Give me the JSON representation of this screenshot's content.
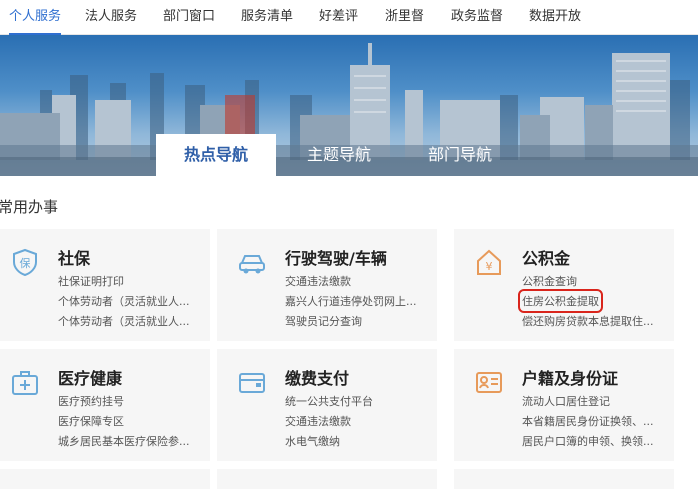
{
  "topnav": {
    "items": [
      "个人服务",
      "法人服务",
      "部门窗口",
      "服务清单",
      "好差评",
      "浙里督",
      "政务监督",
      "数据开放"
    ],
    "active_index": 0
  },
  "banner_tabs": {
    "items": [
      "热点导航",
      "主题导航",
      "部门导航"
    ],
    "active_index": 0
  },
  "section": {
    "title": "常用办事"
  },
  "cards": [
    {
      "title": "社保",
      "icon": "social-security-icon",
      "links": [
        "社保证明打印",
        "个体劳动者（灵活就业人...",
        "个体劳动者（灵活就业人..."
      ]
    },
    {
      "title": "行驶驾驶/车辆",
      "icon": "car-icon",
      "links": [
        "交通违法缴款",
        "嘉兴人行道违停处罚网上...",
        "驾驶员记分查询"
      ]
    },
    {
      "title": "公积金",
      "icon": "house-yuan-icon",
      "links": [
        "公积金查询",
        "住房公积金提取",
        "偿还购房贷款本息提取住..."
      ],
      "highlight_index": 1
    },
    {
      "title": "医疗健康",
      "icon": "medical-kit-icon",
      "links": [
        "医疗预约挂号",
        "医疗保障专区",
        "城乡居民基本医疗保险参..."
      ]
    },
    {
      "title": "缴费支付",
      "icon": "wallet-icon",
      "links": [
        "统一公共支付平台",
        "交通违法缴款",
        "水电气缴纳"
      ]
    },
    {
      "title": "户籍及身份证",
      "icon": "id-card-icon",
      "links": [
        "流动人口居住登记",
        "本省籍居民身份证换领、...",
        "居民户口簿的申领、换领..."
      ]
    }
  ],
  "colors": {
    "accent": "#2f6fd0",
    "icon": "#6aa9d8",
    "icon_orange": "#e79a5a",
    "highlight": "#d9251c"
  }
}
